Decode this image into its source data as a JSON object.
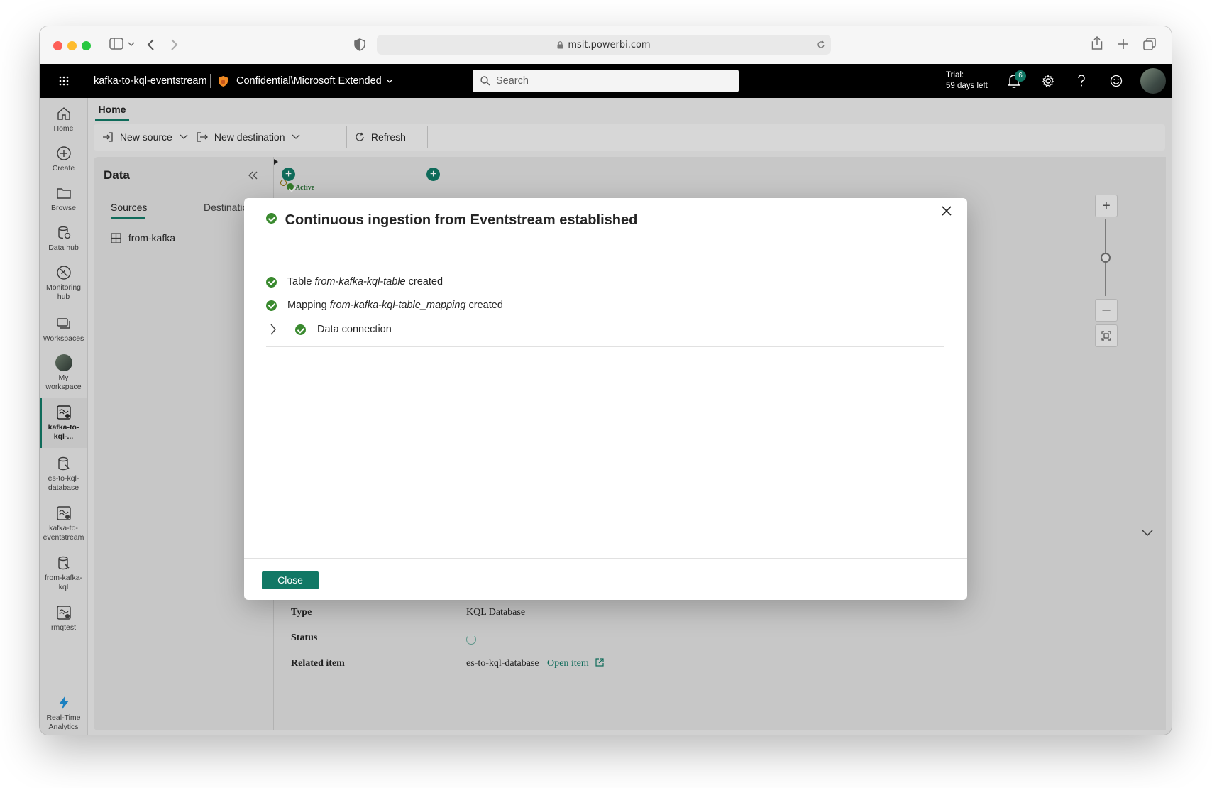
{
  "browser": {
    "url": "msit.powerbi.com"
  },
  "header": {
    "item_name": "kafka-to-kql-eventstream",
    "sensitivity": "Confidential\\Microsoft Extended",
    "search_placeholder": "Search",
    "trial_line1": "Trial:",
    "trial_line2": "59 days left",
    "notification_count": "6"
  },
  "nav": {
    "home": "Home",
    "create": "Create",
    "browse": "Browse",
    "data_hub": "Data hub",
    "monitoring_1": "Monitoring",
    "monitoring_2": "hub",
    "workspaces": "Workspaces",
    "my_ws_1": "My",
    "my_ws_2": "workspace",
    "item1_1": "kafka-to-",
    "item1_2": "kql-...",
    "item2_1": "es-to-kql-",
    "item2_2": "database",
    "item3_1": "kafka-to-",
    "item3_2": "eventstream",
    "item4_1": "from-kafka-",
    "item4_2": "kql",
    "item5_1": "rmqtest",
    "rta_1": "Real-Time",
    "rta_2": "Analytics"
  },
  "tabs": {
    "home": "Home"
  },
  "ribbon": {
    "new_source": "New source",
    "new_destination": "New destination",
    "refresh": "Refresh"
  },
  "data_panel": {
    "title": "Data",
    "tab_sources": "Sources",
    "tab_destinations": "Destinations",
    "source_item": "from-kafka"
  },
  "canvas": {
    "active_label": "Active"
  },
  "details": {
    "type_label": "Type",
    "type_value": "KQL Database",
    "status_label": "Status",
    "related_label": "Related item",
    "related_value": "es-to-kql-database",
    "open_item": "Open item"
  },
  "modal": {
    "title": "Continuous ingestion from Eventstream established",
    "row1_prefix": "Table",
    "row1_name": "from-kafka-kql-table",
    "row1_suffix": "created",
    "row2_prefix": "Mapping",
    "row2_name": "from-kafka-kql-table_mapping",
    "row2_suffix": "created",
    "row3_label": "Data connection",
    "close_button": "Close"
  },
  "colors": {
    "accent": "#117865",
    "success": "#3a8a2f",
    "header_bg": "#000000"
  }
}
